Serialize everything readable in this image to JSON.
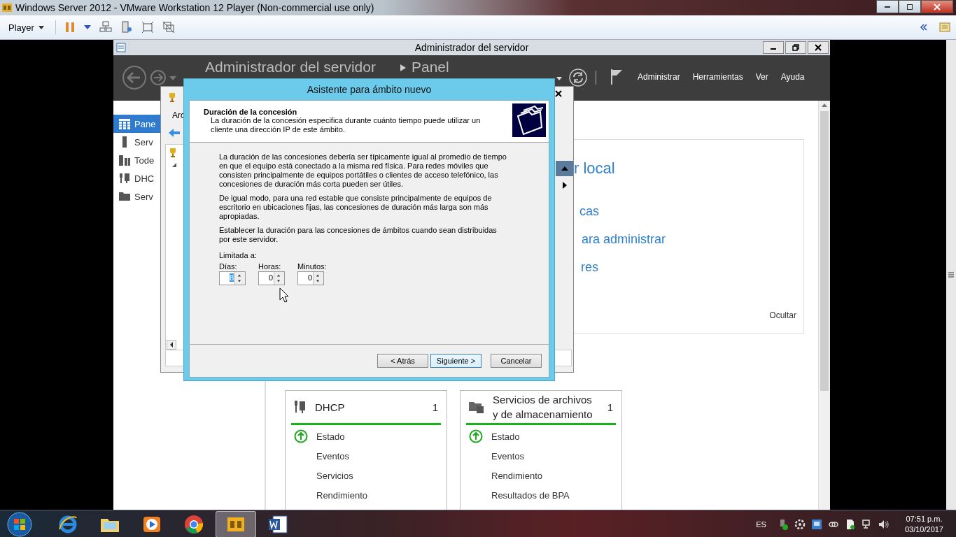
{
  "host_window": {
    "title": "Windows Server 2012 - VMware Workstation 12 Player (Non-commercial use only)"
  },
  "toolbar": {
    "player_menu": "Player"
  },
  "server_manager": {
    "title": "Administrador del servidor",
    "breadcrumb": [
      "Administrador del servidor",
      "Panel"
    ],
    "menu": [
      "Administrar",
      "Herramientas",
      "Ver",
      "Ayuda"
    ],
    "nav": [
      {
        "label": "Pane",
        "kind": "dashboard",
        "selected": true
      },
      {
        "label": "Serv",
        "kind": "server",
        "selected": false
      },
      {
        "label": "Tode",
        "kind": "servers",
        "selected": false
      },
      {
        "label": "DHC",
        "kind": "dhcp",
        "selected": false
      },
      {
        "label": "Serv",
        "kind": "files",
        "selected": false
      }
    ],
    "welcome_fragments": [
      "r local",
      "cas",
      "ara administrar",
      "res"
    ],
    "hide_link": "Ocultar",
    "tiles": [
      {
        "title": "DHCP",
        "kind": "dhcp",
        "count": "1",
        "items": [
          {
            "label": "Estado",
            "ok": true
          },
          {
            "label": "Eventos",
            "ok": false
          },
          {
            "label": "Servicios",
            "ok": false
          },
          {
            "label": "Rendimiento",
            "ok": false
          }
        ]
      },
      {
        "title": "Servicios de archivos y de almacenamiento",
        "kind": "files",
        "count": "1",
        "items": [
          {
            "label": "Estado",
            "ok": true
          },
          {
            "label": "Eventos",
            "ok": false
          },
          {
            "label": "Rendimiento",
            "ok": false
          },
          {
            "label": "Resultados de BPA",
            "ok": false
          }
        ]
      }
    ]
  },
  "dhcp_console": {
    "menu_fragment": "Arc"
  },
  "wizard": {
    "title": "Asistente para ámbito nuevo",
    "heading": "Duración de la concesión",
    "subheading": "La duración de la concesión especifica durante cuánto tiempo puede utilizar un cliente una dirección IP de este ámbito.",
    "paragraphs": [
      "La duración de las concesiones debería ser típicamente igual al promedio de tiempo en que el equipo está conectado a la misma red física. Para redes móviles que consisten principalmente de equipos portátiles o clientes de acceso telefónico, las concesiones de duración más corta pueden ser útiles.",
      "De igual modo, para una red estable que consiste principalmente de equipos de escritorio en ubicaciones fijas, las concesiones de duración más larga son más apropiadas.",
      "Establecer la duración para las concesiones de ámbitos cuando sean distribuidas por este servidor."
    ],
    "limit_label": "Limitada a:",
    "spinners": [
      {
        "label": "Días:",
        "value": "8",
        "focused": true
      },
      {
        "label": "Horas:",
        "value": "0",
        "focused": false
      },
      {
        "label": "Minutos:",
        "value": "0",
        "focused": false
      }
    ],
    "buttons": [
      {
        "label": "< Atrás",
        "default": false
      },
      {
        "label": "Siguiente >",
        "default": true
      },
      {
        "label": "Cancelar",
        "default": false
      }
    ]
  },
  "taskbar": {
    "apps": [
      {
        "kind": "ie",
        "active": false
      },
      {
        "kind": "explorer",
        "active": false
      },
      {
        "kind": "media",
        "active": false
      },
      {
        "kind": "chrome",
        "active": false
      },
      {
        "kind": "vmware",
        "active": true
      },
      {
        "kind": "word",
        "active": false
      }
    ],
    "language": "ES",
    "time": "07:51 p.m.",
    "date": "03/10/2017"
  }
}
